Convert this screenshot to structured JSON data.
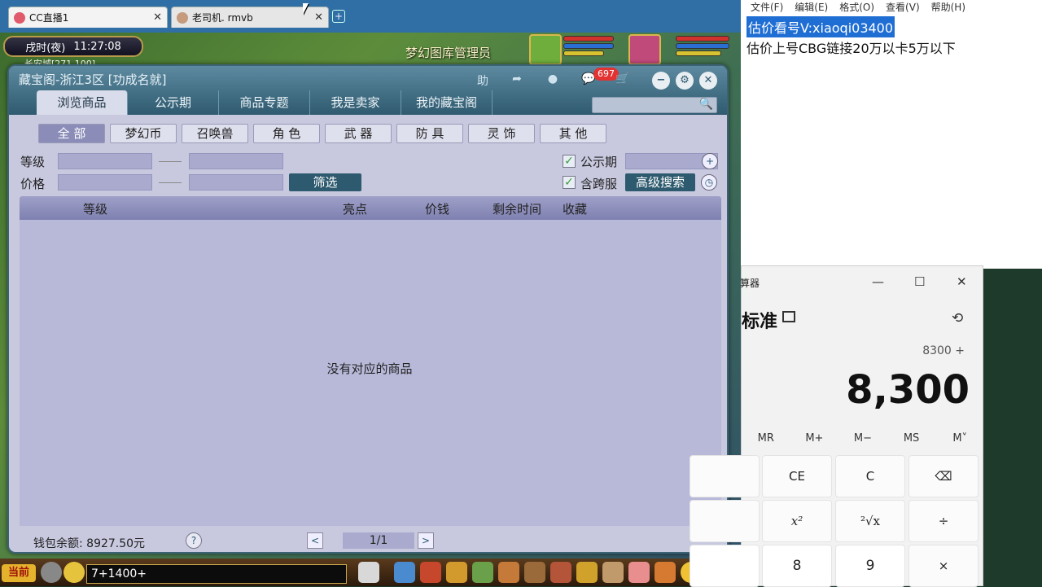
{
  "browser": {
    "tabs": [
      {
        "label": "CC直播1",
        "close": "✕"
      },
      {
        "label": "老司机. rmvb",
        "close": "✕"
      }
    ],
    "new_tab": "+"
  },
  "game": {
    "time_period": "戌时(夜)",
    "time": "11:27:08",
    "location": "长安城[271,100]",
    "banner": "梦幻图库管理员",
    "bottom": {
      "current_channel": "当前",
      "chat_text": "7+1400+"
    }
  },
  "cbg": {
    "title": "藏宝阁-浙江3区 [功成名就]",
    "header_icons": {
      "help": "助",
      "share": "➦",
      "record": "●",
      "chat": "💬",
      "cart": "🛒"
    },
    "message_count": "697",
    "window_controls": {
      "minimize": "−",
      "settings": "⚙",
      "close": "✕"
    },
    "main_tabs": [
      {
        "label": "浏览商品",
        "active": true
      },
      {
        "label": "公示期",
        "active": false
      },
      {
        "label": "商品专题",
        "active": false
      },
      {
        "label": "我是卖家",
        "active": false
      },
      {
        "label": "我的藏宝阁",
        "active": false
      }
    ],
    "search_placeholder": "",
    "search_icon": "🔍",
    "sub_tabs": [
      {
        "label": "全 部",
        "active": true
      },
      {
        "label": "梦幻币",
        "active": false
      },
      {
        "label": "召唤兽",
        "active": false
      },
      {
        "label": "角 色",
        "active": false
      },
      {
        "label": "武 器",
        "active": false
      },
      {
        "label": "防 具",
        "active": false
      },
      {
        "label": "灵 饰",
        "active": false
      },
      {
        "label": "其 他",
        "active": false
      }
    ],
    "filters": {
      "level_label": "等级",
      "price_label": "价格",
      "filter_button": "筛选",
      "public_period_label": "公示期",
      "public_period_checked": true,
      "cross_server_label": "含跨服",
      "cross_server_checked": true,
      "advanced_search": "高级搜索",
      "add_icon": "+",
      "clock_icon": "◷"
    },
    "columns": [
      "等级",
      "亮点",
      "价钱",
      "剩余时间",
      "收藏"
    ],
    "empty_text": "没有对应的商品",
    "footer": {
      "wallet": "钱包余额: 8927.50元",
      "help": "?",
      "prev": "<",
      "page": "1/1",
      "next": ">"
    }
  },
  "notepad": {
    "menu": [
      "文件(F)",
      "编辑(E)",
      "格式(O)",
      "查看(V)",
      "帮助(H)"
    ],
    "lines": [
      "估价看号V:xiaoqi03400",
      "估价上号CBG链接20万以卡5万以下"
    ]
  },
  "calculator": {
    "title": "算器",
    "controls": {
      "minimize": "—",
      "maximize": "☐",
      "close": "✕"
    },
    "mode": "标准",
    "history_icon": "⟲",
    "expression": "8300 +",
    "display": "8,300",
    "memory": [
      "MR",
      "M+",
      "M−",
      "MS",
      "M˅"
    ],
    "buttons": [
      [
        "CE",
        "C",
        "⌫"
      ],
      [
        "x²",
        "²√x",
        "÷"
      ],
      [
        "8",
        "9",
        "×"
      ]
    ]
  },
  "colors": {
    "cbg_header": "#2f5a70",
    "cbg_panel": "#c8c9df",
    "grid_body": "#b8b9d9",
    "selection": "#1f6ed4",
    "badge": "#e23232"
  }
}
